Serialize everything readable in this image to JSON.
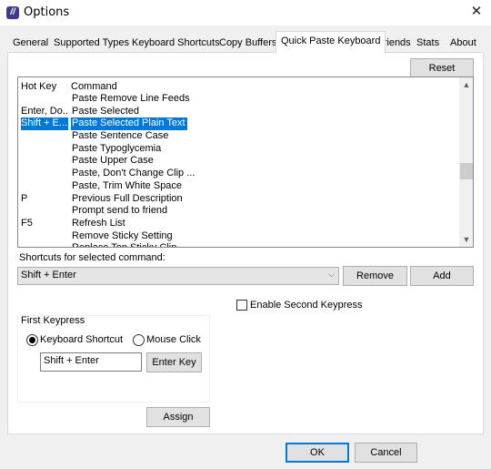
{
  "window": {
    "title": "Options",
    "close_glyph": "✕"
  },
  "tabs": [
    {
      "label": "General"
    },
    {
      "label": "Supported Types"
    },
    {
      "label": "Keyboard Shortcuts"
    },
    {
      "label": "Copy Buffers"
    },
    {
      "label": "Quick Paste Keyboard"
    },
    {
      "label": "Friends"
    },
    {
      "label": "Stats"
    },
    {
      "label": "About"
    }
  ],
  "active_tab": "Quick Paste Keyboard",
  "panel": {
    "reset_label": "Reset",
    "list": {
      "columns": [
        "Hot Key",
        "Command"
      ],
      "rows": [
        {
          "hotkey": "",
          "command": "Paste Remove Line Feeds"
        },
        {
          "hotkey": "Enter, Do...",
          "command": "Paste Selected"
        },
        {
          "hotkey": "Shift + E...",
          "command": "Paste Selected Plain Text",
          "selected": true
        },
        {
          "hotkey": "",
          "command": "Paste Sentence Case"
        },
        {
          "hotkey": "",
          "command": "Paste Typoglycemia"
        },
        {
          "hotkey": "",
          "command": "Paste Upper Case"
        },
        {
          "hotkey": "",
          "command": "Paste, Don't Change Clip ..."
        },
        {
          "hotkey": "",
          "command": "Paste, Trim White Space"
        },
        {
          "hotkey": "P",
          "command": "Previous Full Description"
        },
        {
          "hotkey": "",
          "command": "Prompt send to friend"
        },
        {
          "hotkey": "F5",
          "command": "Refresh List"
        },
        {
          "hotkey": "",
          "command": "Remove Sticky Setting"
        },
        {
          "hotkey": "",
          "command": "Replace Top Sticky Clip"
        }
      ]
    },
    "shortcuts_label": "Shortcuts for selected command:",
    "shortcut_value": "Shift + Enter",
    "remove_label": "Remove",
    "add_label": "Add",
    "enable_second_label": "Enable Second Keypress",
    "first_keypress": {
      "title": "First Keypress",
      "keyboard_shortcut_label": "Keyboard Shortcut",
      "mouse_click_label": "Mouse Click",
      "selected_mode": "Keyboard Shortcut",
      "key_value": "Shift + Enter",
      "enter_key_label": "Enter Key",
      "assign_label": "Assign"
    }
  },
  "footer": {
    "ok_label": "OK",
    "cancel_label": "Cancel"
  }
}
